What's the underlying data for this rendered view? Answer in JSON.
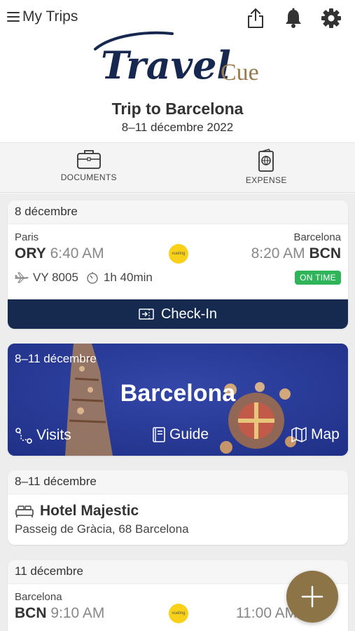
{
  "header": {
    "menu_label": "My Trips",
    "icons": [
      "share-icon",
      "bell-icon",
      "gear-icon"
    ]
  },
  "logo": {
    "word1": "Travel",
    "word2": "Cue"
  },
  "trip": {
    "title": "Trip to Barcelona",
    "dates": "8–11 décembre 2022"
  },
  "quickbar": {
    "documents": "DOCUMENTS",
    "expense": "EXPENSE"
  },
  "flight1": {
    "date": "8 décembre",
    "from_city": "Paris",
    "from_code": "ORY",
    "dep_time": "6:40 AM",
    "to_city": "Barcelona",
    "to_code": "BCN",
    "arr_time": "8:20 AM",
    "airline_logo": "vueling",
    "flight_no": "VY 8005",
    "duration": "1h 40min",
    "status": "ON TIME",
    "checkin": "Check-In"
  },
  "destination": {
    "dates": "8–11 décembre",
    "city": "Barcelona",
    "visits": "Visits",
    "guide": "Guide",
    "map": "Map"
  },
  "hotel": {
    "date": "8–11 décembre",
    "name": "Hotel Majestic",
    "address": "Passeig de Gràcia, 68 Barcelona"
  },
  "flight2": {
    "date": "11 décembre",
    "from_city": "Barcelona",
    "from_code": "BCN",
    "dep_time": "9:10 AM",
    "arr_time": "11:00 AM",
    "airline_logo": "vueling"
  },
  "colors": {
    "checkin_bar": "#152a4e",
    "status_green": "#2fb45a",
    "destination_blue": "#23379a",
    "fab_brown": "#8d7446",
    "vueling_yellow": "#f8d118"
  }
}
